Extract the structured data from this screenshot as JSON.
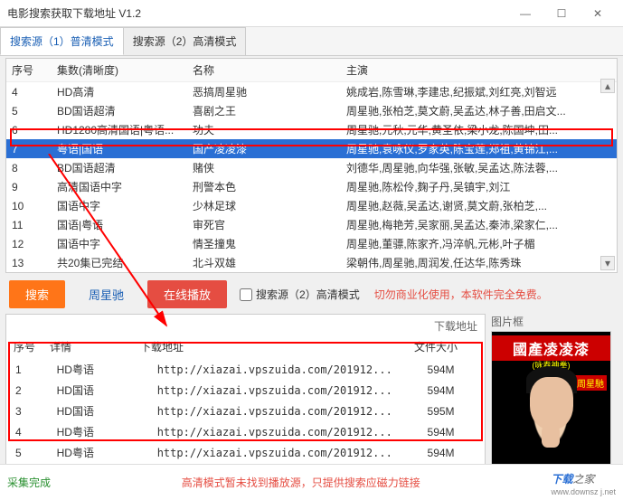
{
  "window": {
    "title": "电影搜索获取下载地址 V1.2"
  },
  "tabs": [
    {
      "label": "搜索源（1）普清模式",
      "active": true
    },
    {
      "label": "搜索源（2）高清模式",
      "active": false
    }
  ],
  "table1": {
    "headers": {
      "seq": "序号",
      "episodes": "集数(清晰度)",
      "name": "名称",
      "cast": "主演"
    },
    "rows": [
      {
        "seq": "4",
        "ep": "HD高清",
        "name": "恶搞周星驰",
        "cast": "姚成岩,陈雪琳,李建忠,纪振斌,刘红亮,刘智远"
      },
      {
        "seq": "5",
        "ep": "BD国语超清",
        "name": "喜剧之王",
        "cast": "周星驰,张柏芝,莫文蔚,吴孟达,林子善,田启文..."
      },
      {
        "seq": "6",
        "ep": "HD1280高清国语|粤语...",
        "name": "功夫",
        "cast": "周星驰,元秋,元华,黄圣依,梁小龙,陈国坤,田..."
      },
      {
        "seq": "7",
        "ep": "粤语|国语",
        "name": "国产凌凌漆",
        "cast": "周星驰,袁咏仪,罗家英,陈宝莲,郑祖,黄锦江,...",
        "selected": true
      },
      {
        "seq": "8",
        "ep": "BD国语超清",
        "name": "赌侠",
        "cast": "刘德华,周星驰,向华强,张敏,吴孟达,陈法蓉,..."
      },
      {
        "seq": "9",
        "ep": "高清国语中字",
        "name": "刑警本色",
        "cast": "周星驰,陈松伶,麹子丹,吴镇宇,刘江"
      },
      {
        "seq": "10",
        "ep": "国语中字",
        "name": "少林足球",
        "cast": "周星驰,赵薇,吴孟达,谢贤,莫文蔚,张柏芝,..."
      },
      {
        "seq": "11",
        "ep": "国语|粤语",
        "name": "审死官",
        "cast": "周星驰,梅艳芳,吴家丽,吴孟达,秦沛,梁家仁,..."
      },
      {
        "seq": "12",
        "ep": "国语中字",
        "name": "情圣撞鬼",
        "cast": "周星驰,董骠,陈家齐,冯淬帆,元彬,叶子楣"
      },
      {
        "seq": "13",
        "ep": "共20集已完结",
        "name": "北斗双雄",
        "cast": "梁朝伟,周星驰,周润发,任达华,陈秀珠"
      }
    ]
  },
  "toolbar": {
    "search_btn": "搜索",
    "keyword": "周星驰",
    "play_btn": "在线播放",
    "source_check": "搜索源（2）高清模式",
    "warning": "切勿商业化使用，本软件完全免费。"
  },
  "download": {
    "addr_label": "下载地址",
    "pic_label": "图片框",
    "headers": {
      "seq": "序号",
      "detail": "详情",
      "url": "下载地址",
      "size": "文件大小"
    },
    "rows": [
      {
        "seq": "1",
        "detail": "HD粤语",
        "url": "http://xiazai.vpszuida.com/201912...",
        "size": "594M"
      },
      {
        "seq": "2",
        "detail": "HD国语",
        "url": "http://xiazai.vpszuida.com/201912...",
        "size": "594M"
      },
      {
        "seq": "3",
        "detail": "HD国语",
        "url": "http://xiazai.vpszuida.com/201912...",
        "size": "595M"
      },
      {
        "seq": "4",
        "detail": "HD粤语",
        "url": "http://xiazai.vpszuida.com/201912...",
        "size": "594M"
      },
      {
        "seq": "5",
        "detail": "HD粤语",
        "url": "http://xiazai.vpszuida.com/201912...",
        "size": "594M"
      }
    ]
  },
  "poster": {
    "title": "國產凌凌漆",
    "subtitle": "(咏春神拳)",
    "badge": "周星馳"
  },
  "status": {
    "done": "采集完成",
    "note": "高清模式暂未找到播放源，只提供搜索应磁力链接",
    "brand_left": "下载",
    "brand_right": "之家",
    "brand_url": "www.downsz j.net"
  }
}
